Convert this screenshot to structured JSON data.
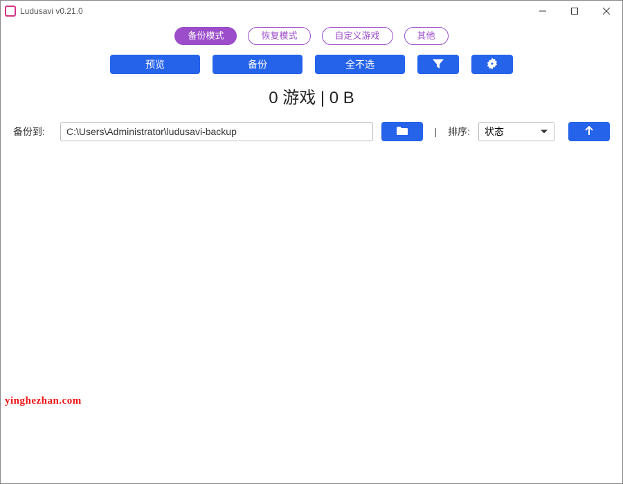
{
  "window": {
    "title": "Ludusavi v0.21.0"
  },
  "modes": {
    "backup": "备份模式",
    "restore": "恢复模式",
    "custom": "自定义游戏",
    "other": "其他",
    "active": "backup"
  },
  "actions": {
    "preview": "预览",
    "backup": "备份",
    "select_none": "全不选"
  },
  "summary": "0 游戏  |  0 B",
  "path": {
    "label": "备份到:",
    "value": "C:\\Users\\Administrator\\ludusavi-backup"
  },
  "sort": {
    "label": "排序:",
    "selected": "状态"
  },
  "watermark": "yinghezhan.com"
}
